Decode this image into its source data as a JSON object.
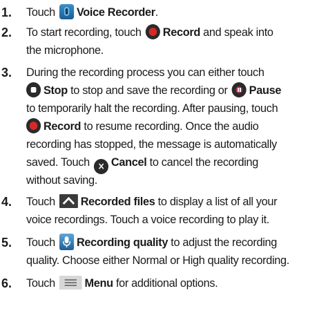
{
  "steps": [
    {
      "num": "1.",
      "lines": [
        {
          "pre": "Touch",
          "icon": "voice-recorder-app-icon",
          "bold": "Voice Recorder",
          "post": "."
        }
      ]
    },
    {
      "num": "2.",
      "lines": [
        {
          "pre": "To start recording, touch",
          "icon": "record-icon",
          "bold": "Record",
          "post": " and speak into"
        },
        {
          "text": "the microphone."
        }
      ]
    },
    {
      "num": "3.",
      "lines": [
        {
          "text": "During the recording process you can either touch"
        },
        {
          "icon": "stop-icon",
          "bold": "Stop",
          "post": " to stop and save the recording or",
          "icon2": "pause-icon",
          "bold2": "Pause"
        },
        {
          "text": "to temporarily halt the recording. After pausing, touch"
        },
        {
          "icon": "record-icon",
          "bold": "Record",
          "post": " to resume recording. Once the audio"
        },
        {
          "text": "recording has stopped, the message is automatically"
        },
        {
          "pre": "saved. Touch",
          "icon": "cancel-icon",
          "bold": "Cancel",
          "post": " to cancel the recording"
        },
        {
          "text": "without saving."
        }
      ]
    },
    {
      "num": "4.",
      "lines": [
        {
          "pre": "Touch",
          "icon": "recorded-files-icon",
          "bold": "Recorded files",
          "post": " to display a list of all your"
        },
        {
          "text": "voice recordings. Touch a voice recording to play it."
        }
      ]
    },
    {
      "num": "5.",
      "lines": [
        {
          "pre": "Touch",
          "icon": "recording-quality-icon",
          "bold": "Recording quality",
          "post": " to adjust the recording"
        },
        {
          "text": "quality. Choose either Normal or High quality recording."
        }
      ]
    },
    {
      "num": "6.",
      "lines": [
        {
          "pre": "Touch",
          "icon": "menu-icon",
          "bold": "Menu",
          "post": " for additional options."
        }
      ]
    }
  ]
}
